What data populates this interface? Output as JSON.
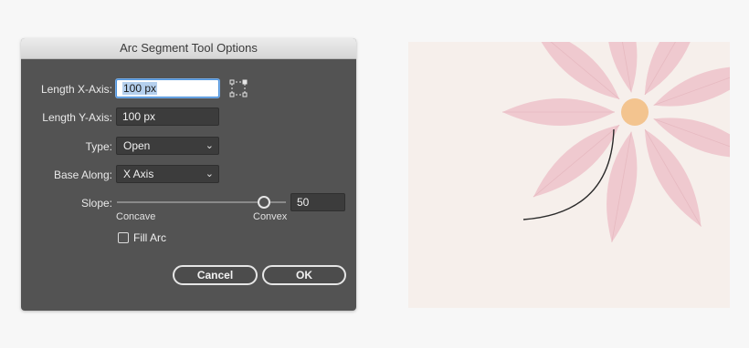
{
  "dialog": {
    "title": "Arc Segment Tool Options",
    "length_x": {
      "label": "Length X-Axis:",
      "value": "100 px"
    },
    "length_y": {
      "label": "Length Y-Axis:",
      "value": "100 px"
    },
    "type": {
      "label": "Type:",
      "value": "Open"
    },
    "base_along": {
      "label": "Base Along:",
      "value": "X Axis"
    },
    "slope": {
      "label": "Slope:",
      "value": "50",
      "level_percent": 90,
      "left_label": "Concave",
      "right_label": "Convex"
    },
    "fill_arc": {
      "label": "Fill Arc",
      "checked": false
    },
    "cancel_label": "Cancel",
    "ok_label": "OK"
  },
  "artwork": {
    "petal_color": "#efc9cf",
    "center_color": "#f3c48f",
    "background_color": "#f6efeb",
    "arc_stroke_color": "#2a2a2a"
  }
}
